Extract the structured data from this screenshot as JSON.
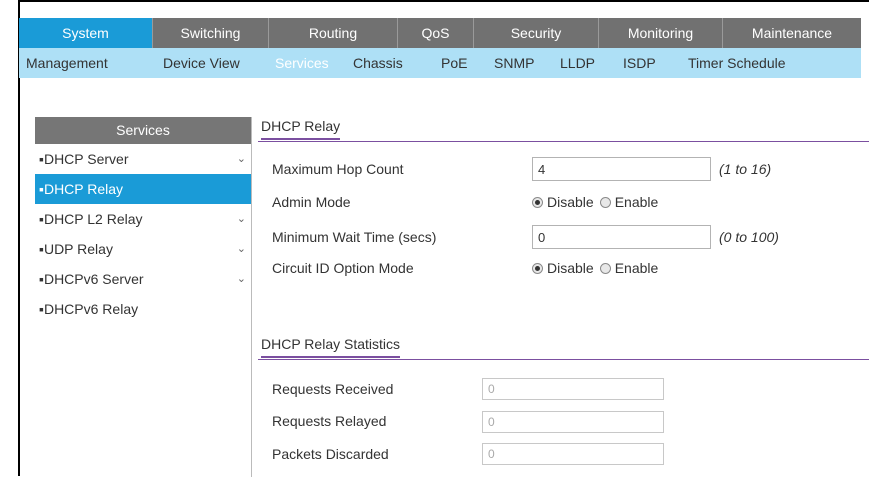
{
  "topnav": {
    "tabs": [
      {
        "label": "System",
        "width": 134,
        "active": true
      },
      {
        "label": "Switching",
        "width": 116,
        "active": false
      },
      {
        "label": "Routing",
        "width": 129,
        "active": false
      },
      {
        "label": "QoS",
        "width": 76,
        "active": false
      },
      {
        "label": "Security",
        "width": 125,
        "active": false
      },
      {
        "label": "Monitoring",
        "width": 124,
        "active": false
      },
      {
        "label": "Maintenance",
        "width": 138,
        "active": false
      }
    ]
  },
  "subnav": {
    "items": [
      {
        "label": "Management",
        "active": false
      },
      {
        "label": "Device View",
        "active": false
      },
      {
        "label": "Services",
        "active": true
      },
      {
        "label": "Chassis",
        "active": false
      },
      {
        "label": "PoE",
        "active": false
      },
      {
        "label": "SNMP",
        "active": false
      },
      {
        "label": "LLDP",
        "active": false
      },
      {
        "label": "ISDP",
        "active": false
      },
      {
        "label": "Timer Schedule",
        "active": false
      }
    ]
  },
  "sidebar": {
    "title": "Services",
    "items": [
      {
        "label": "▪DHCP Server",
        "expandable": true,
        "active": false
      },
      {
        "label": "▪DHCP Relay",
        "expandable": false,
        "active": true
      },
      {
        "label": "▪DHCP L2 Relay",
        "expandable": true,
        "active": false
      },
      {
        "label": "▪UDP Relay",
        "expandable": true,
        "active": false
      },
      {
        "label": "▪DHCPv6 Server",
        "expandable": true,
        "active": false
      },
      {
        "label": "▪DHCPv6 Relay",
        "expandable": false,
        "active": false
      }
    ],
    "chevron": "⌄"
  },
  "relay": {
    "title": "DHCP Relay",
    "max_hop": {
      "label": "Maximum Hop Count",
      "value": "4",
      "range": "(1 to 16)"
    },
    "admin_mode": {
      "label": "Admin Mode",
      "options": [
        "Disable",
        "Enable"
      ],
      "selected": "Disable"
    },
    "min_wait": {
      "label": "Minimum Wait Time (secs)",
      "value": "0",
      "range": "(0 to 100)"
    },
    "circuit_id": {
      "label": "Circuit ID Option Mode",
      "options": [
        "Disable",
        "Enable"
      ],
      "selected": "Disable"
    }
  },
  "stats": {
    "title": "DHCP Relay Statistics",
    "requests_received": {
      "label": "Requests Received",
      "value": "0"
    },
    "requests_relayed": {
      "label": "Requests Relayed",
      "value": "0"
    },
    "packets_discarded": {
      "label": "Packets Discarded",
      "value": "0"
    }
  },
  "colors": {
    "accent": "#1a9bd7",
    "subnav_bg": "#aee0f6",
    "header_gray": "#717171",
    "section_rule": "#7b4fa0"
  }
}
